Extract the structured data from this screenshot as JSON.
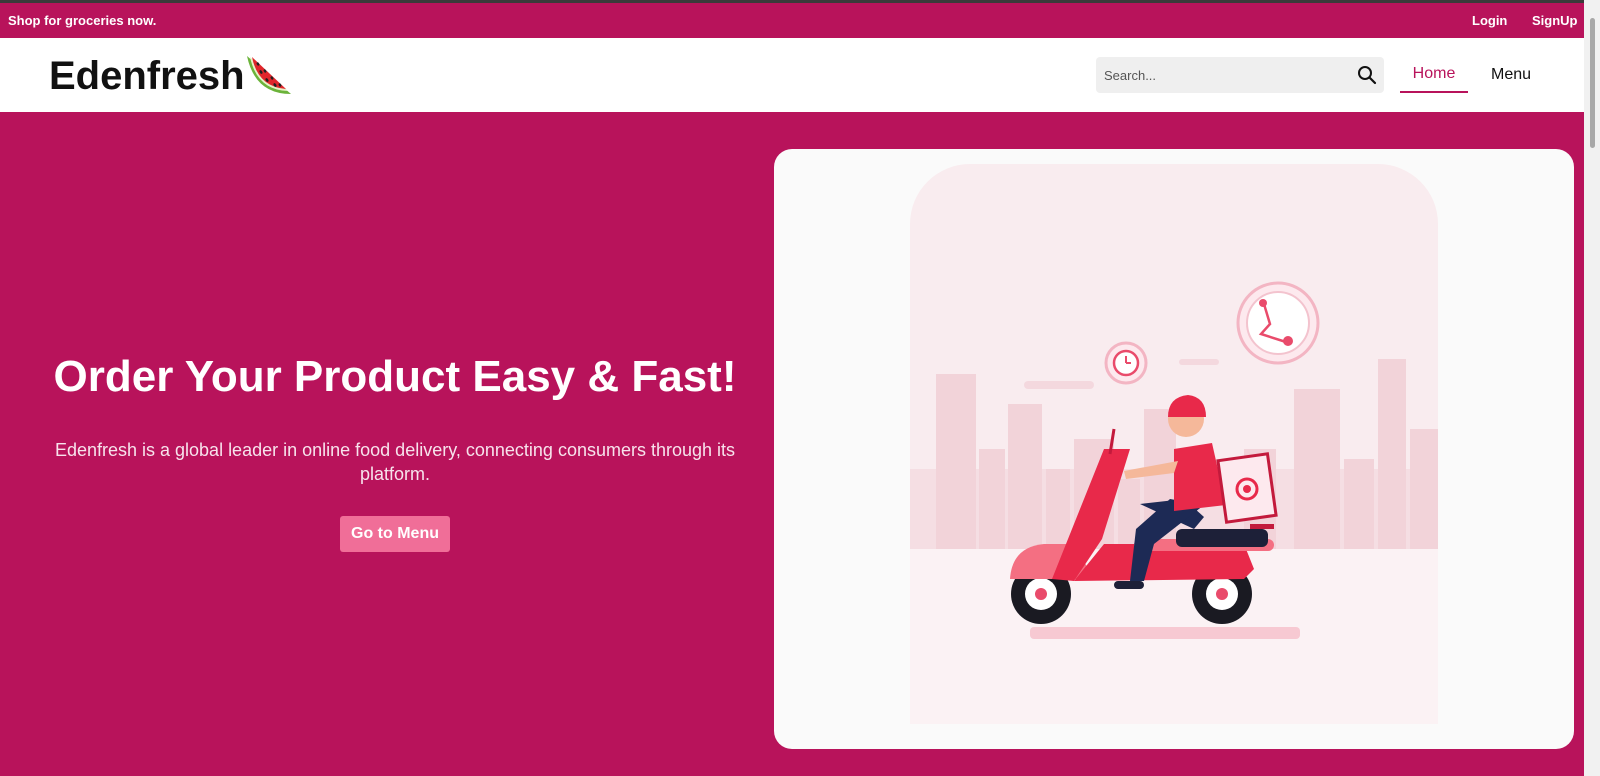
{
  "topbar": {
    "promo": "Shop for groceries now.",
    "login": "Login",
    "signup": "SignUp"
  },
  "header": {
    "brand": "Edenfresh",
    "logo_icon": "watermelon-icon",
    "search_placeholder": "Search...",
    "search_icon": "search-icon",
    "nav": {
      "home": "Home",
      "menu": "Menu"
    },
    "active_nav": "Home"
  },
  "hero": {
    "title": "Order Your Product Easy & Fast!",
    "description": "Edenfresh is a global leader in online food delivery, connecting consumers through its platform.",
    "cta_label": "Go to Menu",
    "illustration": "delivery-scooter-illustration"
  },
  "colors": {
    "brand": "#b8135b",
    "cta": "#f06e98",
    "header_bg": "#ffffff",
    "card_bg": "#fafafa"
  }
}
